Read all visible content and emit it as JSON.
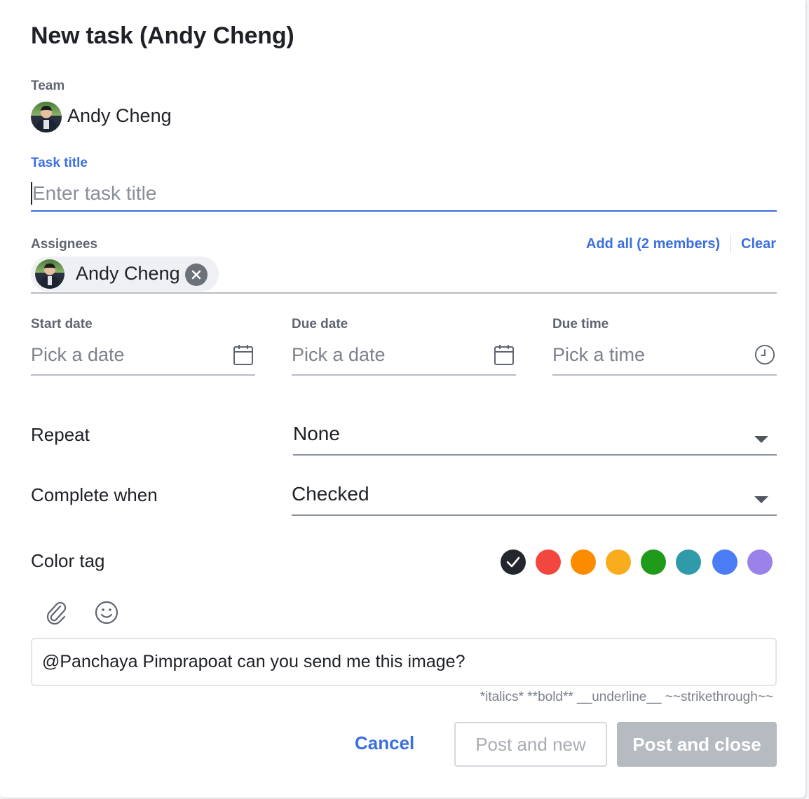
{
  "dialog": {
    "title": "New task (Andy Cheng)"
  },
  "team": {
    "label": "Team",
    "name": "Andy Cheng"
  },
  "task_title": {
    "label": "Task title",
    "placeholder": "Enter task title"
  },
  "assignees": {
    "label": "Assignees",
    "add_all": "Add all (2 members)",
    "clear": "Clear",
    "chips": [
      {
        "name": "Andy Cheng"
      }
    ]
  },
  "dates": {
    "start": {
      "label": "Start date",
      "placeholder": "Pick a date"
    },
    "due": {
      "label": "Due date",
      "placeholder": "Pick a date"
    },
    "due_time": {
      "label": "Due time",
      "placeholder": "Pick a time"
    }
  },
  "repeat": {
    "label": "Repeat",
    "value": "None"
  },
  "complete_when": {
    "label": "Complete when",
    "value": "Checked"
  },
  "color_tag": {
    "label": "Color tag",
    "colors": [
      "#23262d",
      "#f2473e",
      "#fb8c00",
      "#f9ad1c",
      "#1f9a1b",
      "#2f9aa8",
      "#4a7cf6",
      "#9b82e8"
    ],
    "selected_index": 0
  },
  "toolbar": {
    "icons": [
      "paperclip-icon",
      "smiley-icon"
    ]
  },
  "message": {
    "text": "@Panchaya Pimprapoat can you send me this image?",
    "format_hint": "*italics* **bold** __underline__ ~~strikethrough~~"
  },
  "actions": {
    "cancel": "Cancel",
    "post_and_new": "Post and new",
    "post_and_close": "Post and close"
  }
}
